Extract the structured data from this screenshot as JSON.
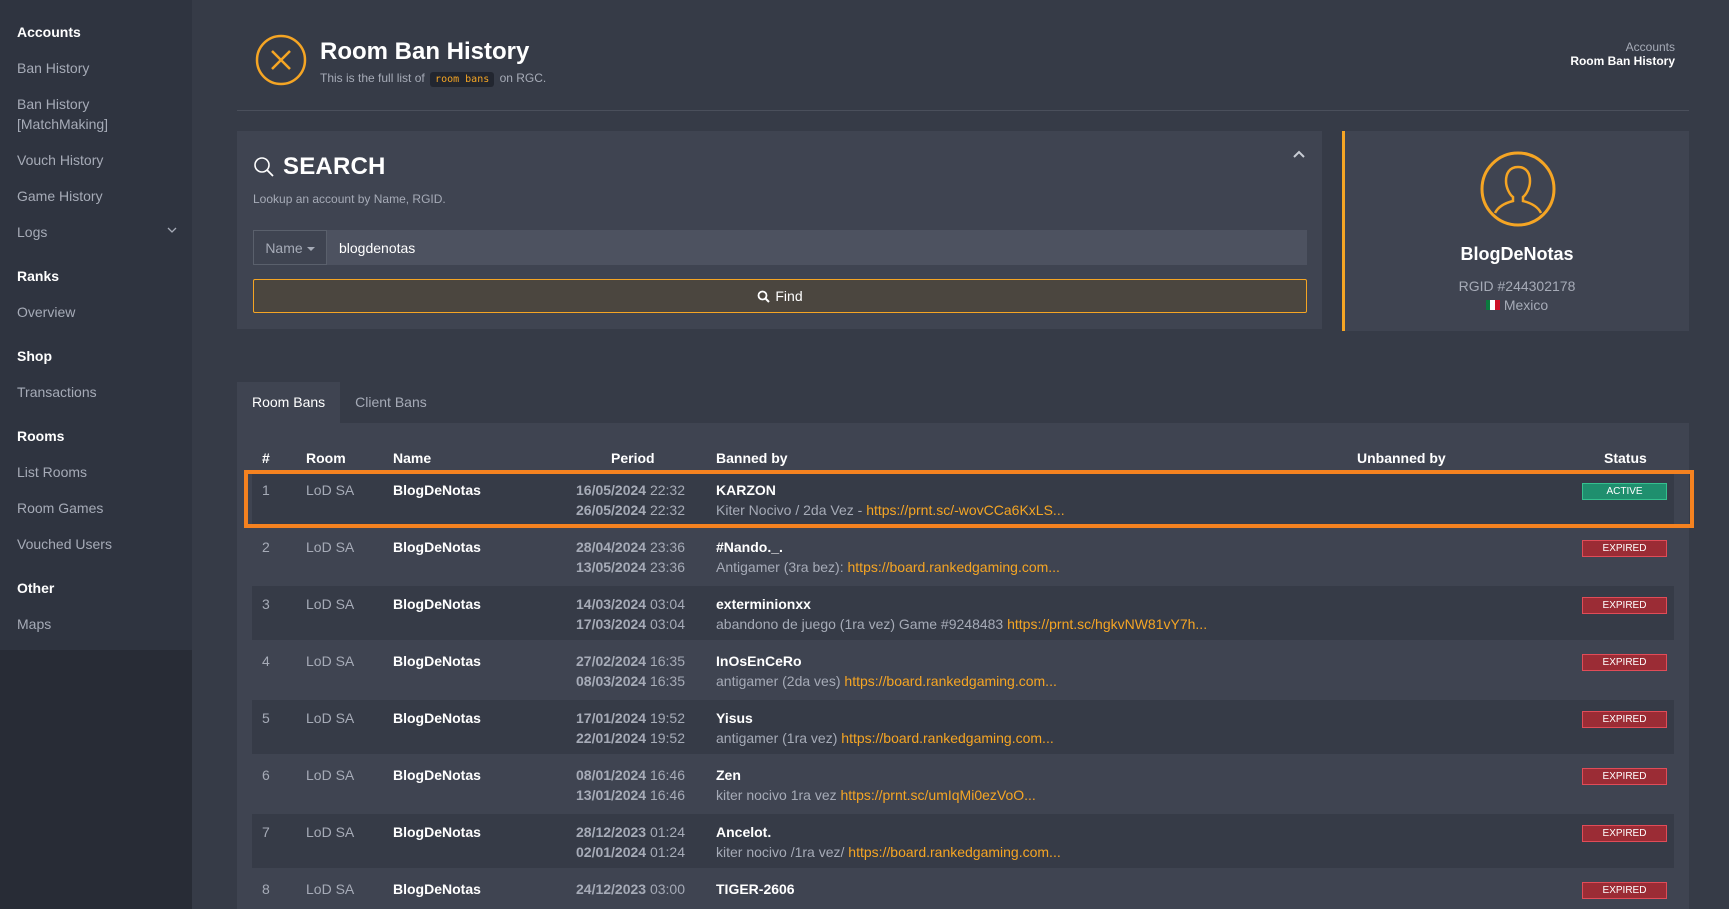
{
  "sidebar": {
    "groups": [
      {
        "heading": "Accounts",
        "items": [
          "Ban History",
          "Ban History [MatchMaking]",
          "Vouch History",
          "Game History",
          "Logs"
        ]
      },
      {
        "heading": "Ranks",
        "items": [
          "Overview"
        ]
      },
      {
        "heading": "Shop",
        "items": [
          "Transactions"
        ]
      },
      {
        "heading": "Rooms",
        "items": [
          "List Rooms",
          "Room Games",
          "Vouched Users"
        ]
      },
      {
        "heading": "Other",
        "items": [
          "Maps"
        ]
      }
    ]
  },
  "header": {
    "title": "Room Ban History",
    "sub_before": "This is the full list of",
    "sub_code": "room bans",
    "sub_after": "on RGC.",
    "breadcrumb": [
      "Accounts",
      "Room Ban History"
    ]
  },
  "search": {
    "title": "SEARCH",
    "description": "Lookup an account by Name, RGID.",
    "dropdown": "Name",
    "value": "blogdenotas",
    "find_label": "Find"
  },
  "profile": {
    "name": "BlogDeNotas",
    "rgid": "RGID #244302178",
    "country": "Mexico"
  },
  "tabs": [
    "Room Bans",
    "Client Bans"
  ],
  "table": {
    "headers": {
      "num": "#",
      "room": "Room",
      "name": "Name",
      "period": "Period",
      "banned_by": "Banned by",
      "unbanned_by": "Unbanned by",
      "status": "Status"
    },
    "rows": [
      {
        "num": "1",
        "room": "LoD SA",
        "name": "BlogDeNotas",
        "start_date": "16/05/2024",
        "start_time": "22:32",
        "end_date": "26/05/2024",
        "end_time": "22:32",
        "banned_by": "KARZON",
        "reason": "Kiter Nocivo / 2da Vez - ",
        "link": "https://prnt.sc/-wovCCa6KxLS...",
        "status": "ACTIVE"
      },
      {
        "num": "2",
        "room": "LoD SA",
        "name": "BlogDeNotas",
        "start_date": "28/04/2024",
        "start_time": "23:36",
        "end_date": "13/05/2024",
        "end_time": "23:36",
        "banned_by": "#Nando._.",
        "reason": "Antigamer (3ra bez): ",
        "link": "https://board.rankedgaming.com...",
        "status": "EXPIRED"
      },
      {
        "num": "3",
        "room": "LoD SA",
        "name": "BlogDeNotas",
        "start_date": "14/03/2024",
        "start_time": "03:04",
        "end_date": "17/03/2024",
        "end_time": "03:04",
        "banned_by": "exterminionxx",
        "reason": "abandono de juego (1ra vez) Game #9248483 ",
        "link": "https://prnt.sc/hgkvNW81vY7h...",
        "status": "EXPIRED"
      },
      {
        "num": "4",
        "room": "LoD SA",
        "name": "BlogDeNotas",
        "start_date": "27/02/2024",
        "start_time": "16:35",
        "end_date": "08/03/2024",
        "end_time": "16:35",
        "banned_by": "InOsEnCeRo",
        "reason": "antigamer (2da ves) ",
        "link": "https://board.rankedgaming.com...",
        "status": "EXPIRED"
      },
      {
        "num": "5",
        "room": "LoD SA",
        "name": "BlogDeNotas",
        "start_date": "17/01/2024",
        "start_time": "19:52",
        "end_date": "22/01/2024",
        "end_time": "19:52",
        "banned_by": "Yisus",
        "reason": "antigamer (1ra vez) ",
        "link": "https://board.rankedgaming.com...",
        "status": "EXPIRED"
      },
      {
        "num": "6",
        "room": "LoD SA",
        "name": "BlogDeNotas",
        "start_date": "08/01/2024",
        "start_time": "16:46",
        "end_date": "13/01/2024",
        "end_time": "16:46",
        "banned_by": "Zen",
        "reason": "kiter nocivo 1ra vez ",
        "link": "https://prnt.sc/umIqMi0ezVoO...",
        "status": "EXPIRED"
      },
      {
        "num": "7",
        "room": "LoD SA",
        "name": "BlogDeNotas",
        "start_date": "28/12/2023",
        "start_time": "01:24",
        "end_date": "02/01/2024",
        "end_time": "01:24",
        "banned_by": "Ancelot.",
        "reason": "kiter nocivo /1ra vez/ ",
        "link": "https://board.rankedgaming.com...",
        "status": "EXPIRED"
      },
      {
        "num": "8",
        "room": "LoD SA",
        "name": "BlogDeNotas",
        "start_date": "24/12/2023",
        "start_time": "03:00",
        "end_date": "",
        "end_time": "",
        "banned_by": "TIGER-2606",
        "reason": "",
        "link": "",
        "status": "EXPIRED"
      }
    ]
  },
  "colors": {
    "accent": "#f5a524",
    "highlight": "#f58220",
    "active": "#1f8f6e",
    "expired": "#9b2c35"
  }
}
